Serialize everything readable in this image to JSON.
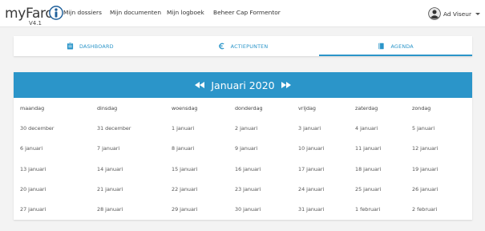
{
  "brand": {
    "name": "myFaro",
    "version": "V4.1",
    "logo_icon": "info-person-icon"
  },
  "nav": {
    "links": [
      "Mijn dossiers",
      "Mijn documenten",
      "Mijn logboek",
      "Beheer Cap Formentor"
    ]
  },
  "user": {
    "name": "Ad Viseur",
    "avatar_icon": "user-avatar-icon"
  },
  "tabs": [
    {
      "label": "DASHBOARD",
      "icon": "clipboard-icon",
      "active": false
    },
    {
      "label": "ACTIEPUNTEN",
      "icon": "euro-icon",
      "active": false
    },
    {
      "label": "AGENDA",
      "icon": "book-icon",
      "active": true
    }
  ],
  "calendar": {
    "title": "Januari 2020",
    "prev_icon": "double-left-arrow-icon",
    "next_icon": "double-right-arrow-icon",
    "weekdays": [
      "maandag",
      "dinsdag",
      "woensdag",
      "donderdag",
      "vrijdag",
      "zaterdag",
      "zondag"
    ],
    "weeks": [
      [
        "30 december",
        "31 december",
        "1 januari",
        "2 januari",
        "3 januari",
        "4 januari",
        "5 januari"
      ],
      [
        "6 januari",
        "7 januari",
        "8 januari",
        "9 januari",
        "10 januari",
        "11 januari",
        "12 januari"
      ],
      [
        "13 januari",
        "14 januari",
        "15 januari",
        "16 januari",
        "17 januari",
        "18 januari",
        "19 januari"
      ],
      [
        "20 januari",
        "21 januari",
        "22 januari",
        "23 januari",
        "24 januari",
        "25 januari",
        "26 januari"
      ],
      [
        "27 januari",
        "28 januari",
        "29 januari",
        "30 januari",
        "31 januari",
        "1 februari",
        "2 februari"
      ]
    ]
  },
  "colors": {
    "accent": "#2b95c9",
    "background": "#f3f3f3"
  }
}
